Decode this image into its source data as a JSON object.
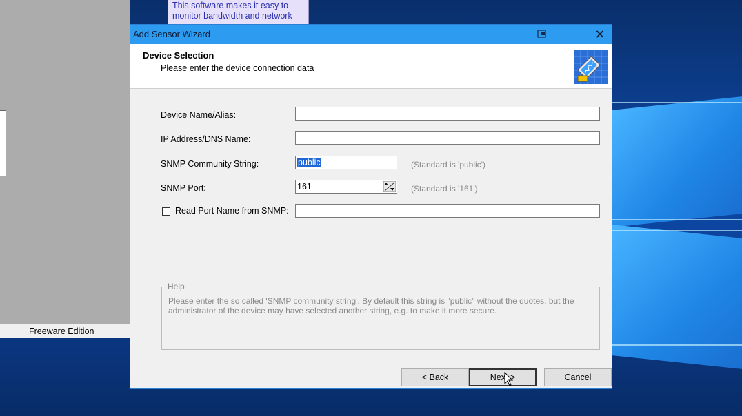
{
  "background_app": {
    "tooltip_lines": [
      "This software makes it easy to",
      "monitor bandwidth and network"
    ],
    "status_bar_text": "Freeware Edition"
  },
  "dialog": {
    "title": "Add Sensor Wizard",
    "header": {
      "title": "Device Selection",
      "subtitle": "Please enter the device connection data"
    },
    "fields": {
      "device_name_label": "Device Name/Alias:",
      "device_name_value": "",
      "ip_label": "IP Address/DNS Name:",
      "ip_value": "",
      "community_label": "SNMP Community String:",
      "community_value": "public",
      "community_hint": "(Standard is 'public')",
      "port_label": "SNMP Port:",
      "port_value": "161",
      "port_hint": "(Standard is '161')",
      "read_port_label": "Read Port Name from SNMP:",
      "read_port_checked": false,
      "read_port_value": ""
    },
    "help": {
      "legend": "Help",
      "text": "Please enter the so called 'SNMP community string'. By default this string is \"public\" without the quotes, but the administrator of the device may have selected another string, e.g. to make it more secure."
    },
    "buttons": {
      "back": "< Back",
      "next": "Next >",
      "cancel": "Cancel"
    }
  },
  "colors": {
    "titlebar": "#2d9cf0",
    "selection": "#1e66d6",
    "hint_text": "#8a8a8a"
  }
}
